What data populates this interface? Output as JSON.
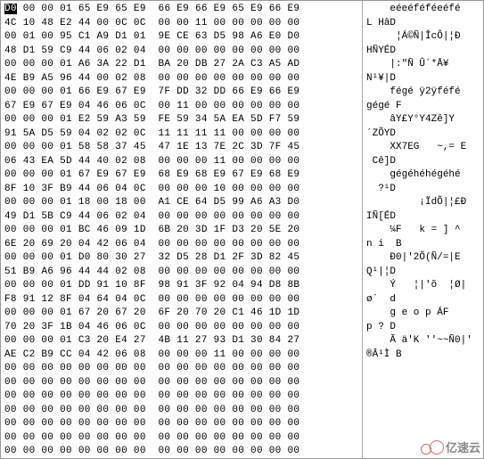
{
  "selected_byte": "D0",
  "hex_rows": [
    "D0 00 00 01 65 E9 65 E9  66 E9 66 E9 65 E9 66 E9",
    "4C 10 48 E2 44 00 0C 0C  00 00 11 00 00 00 00 00",
    "00 01 00 95 C1 A9 D1 01  9E CE 63 D5 98 A6 E0 D0",
    "48 D1 59 C9 44 06 02 04  00 00 00 00 00 00 00 00",
    "00 00 00 01 A6 3A 22 D1  BA 20 DB 27 2A C3 A5 AD",
    "4E B9 A5 96 44 00 02 08  00 00 00 00 00 00 00 00",
    "00 00 00 01 66 E9 67 E9  7F DD 32 DD 66 E9 66 E9",
    "67 E9 67 E9 04 46 06 0C  00 11 00 00 00 00 00 00",
    "00 00 00 01 E2 59 A3 59  FE 59 34 5A EA 5D F7 59",
    "91 5A D5 59 04 02 02 0C  11 11 11 11 00 00 00 00",
    "00 00 00 01 58 58 37 45  47 1E 13 7E 2C 3D 7F 45",
    "06 43 EA 5D 44 40 02 08  00 00 00 11 00 00 00 00",
    "00 00 00 01 67 E9 67 E9  68 E9 68 E9 67 E9 68 E9",
    "8F 10 3F B9 44 06 04 0C  00 00 00 10 00 00 00 00",
    "00 00 00 01 18 00 18 00  A1 CE 64 D5 99 A6 A3 D0",
    "49 D1 5B C9 44 06 02 04  00 00 00 00 00 00 00 00",
    "00 00 00 01 BC 46 09 1D  6B 20 3D 1F D3 20 5E 20",
    "6E 20 69 20 04 42 06 04  00 00 00 00 00 00 00 00",
    "00 00 00 01 D0 80 30 27  32 D5 28 D1 2F 3D 82 45",
    "51 B9 A6 96 44 44 02 08  00 00 00 00 00 00 00 00",
    "00 00 00 01 DD 91 10 8F  98 91 3F 92 04 94 D8 8B",
    "F8 91 12 8F 04 64 04 0C  00 00 00 00 00 00 00 00",
    "00 00 00 01 67 20 67 20  6F 20 70 20 C1 46 1D 1D",
    "70 20 3F 1B 04 46 06 0C  00 00 00 00 00 00 00 00",
    "00 00 00 01 C3 20 E4 27  4B 11 27 93 D1 30 84 27",
    "AE C2 B9 CC 04 42 06 08  00 00 00 11 00 00 00 00",
    "00 00 00 00 00 00 00 00  00 00 00 00 00 00 00 00",
    "00 00 00 00 00 00 00 00  00 00 00 00 00 00 00 00",
    "00 00 00 00 00 00 00 00  00 00 00 00 00 00 00 00",
    "00 00 00 00 00 00 00 00  00 00 00 00 00 00 00 00",
    "00 00 00 00 00 00 00 00  00 00 00 00 00 00 00 00",
    "00 00 00 00 00 00 00 00  00 00 00 00 00 00 00 00",
    "00 00 00 00 00 00 00 00  00 00 00 00 00 00 00 00"
  ],
  "ascii_rows": [
    "    eéeéféféeéfé",
    "L HâD",
    "     ¦Á©Ñ|ÎcÔ|¦Ð",
    "HÑYÉD",
    "    |:\"Ñ Û´*Å¥­",
    "N¹¥|D",
    "    fégé ÿ2ÿféfé",
    "gégé F",
    "    âY£Y°Y4Zê]­Y",
    "´ZÕYD",
    "    XX7EG   ~,= E",
    " Cê]D",
    "    gégéhéhégéhé",
    "  ?¹D",
    "         ¡ÏdÕ|¦£Ð",
    "IÑ[ÉD",
    "    ¼F   k = ] ^",
    "n i  B",
    "    Ð0|'2Õ(Ñ/=|E",
    "Q¹|¦D",
    "    Ý   ¦|'õ  ¦Ø|",
    "ø´  d",
    "    g e o p ÁF",
    "p ? D",
    "    Ã ä'K ''~~Ñ0|'",
    "®Â¹Ì B",
    "",
    "",
    "",
    "",
    "",
    "",
    ""
  ],
  "watermark_text": "亿速云"
}
